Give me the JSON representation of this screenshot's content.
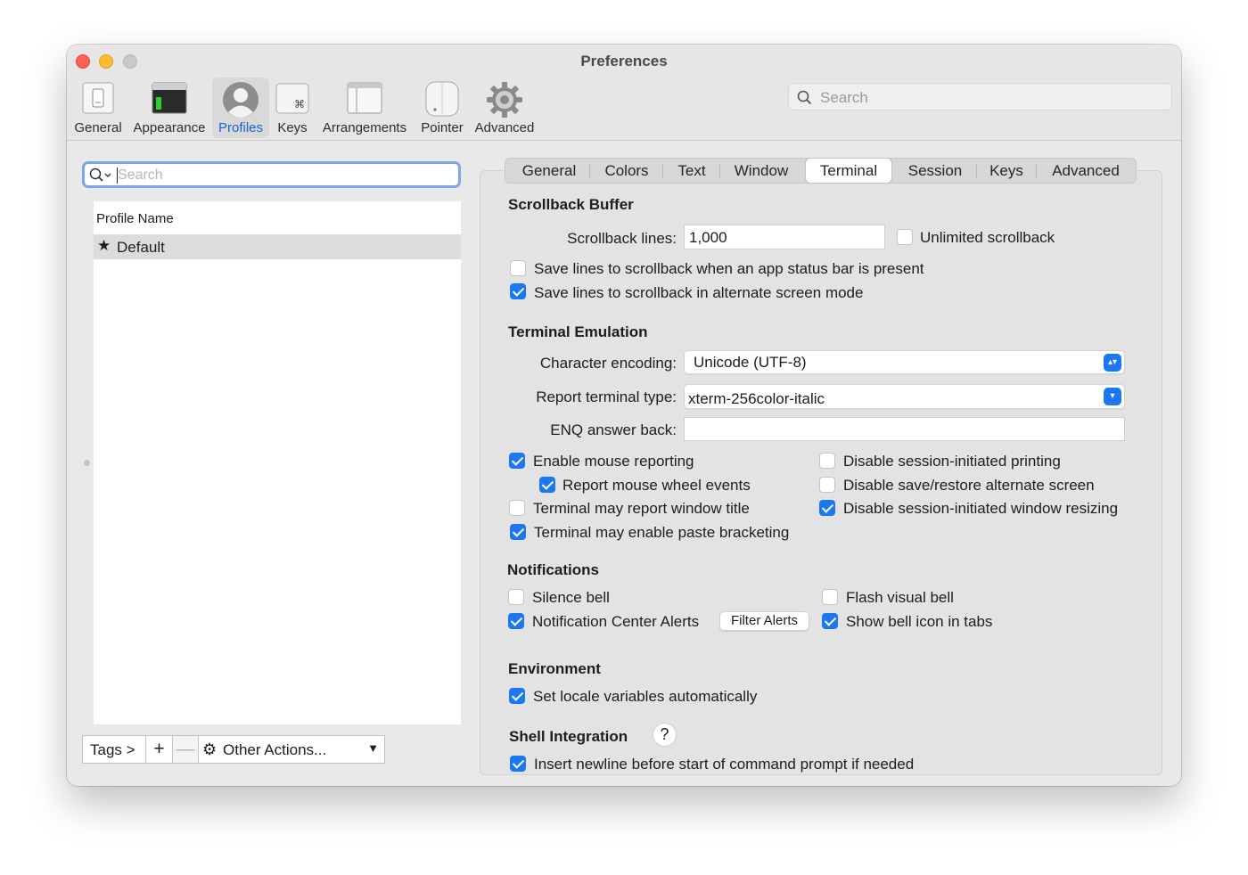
{
  "window": {
    "title": "Preferences"
  },
  "toolbar": {
    "items": [
      {
        "label": "General",
        "icon": "general-icon"
      },
      {
        "label": "Appearance",
        "icon": "appearance-icon"
      },
      {
        "label": "Profiles",
        "icon": "profiles-icon"
      },
      {
        "label": "Keys",
        "icon": "keys-icon"
      },
      {
        "label": "Arrangements",
        "icon": "arrangements-icon"
      },
      {
        "label": "Pointer",
        "icon": "pointer-icon"
      },
      {
        "label": "Advanced",
        "icon": "gear-icon"
      }
    ],
    "selected": "Profiles",
    "search_placeholder": "Search"
  },
  "profiles": {
    "search_placeholder": "Search",
    "column_header": "Profile Name",
    "rows": [
      {
        "name": "Default",
        "is_default": true
      }
    ],
    "tags_label": "Tags >",
    "add_label": "+",
    "remove_label": "—",
    "other_actions_label": "Other Actions..."
  },
  "tabs": {
    "items": [
      "General",
      "Colors",
      "Text",
      "Window",
      "Terminal",
      "Session",
      "Keys",
      "Advanced"
    ],
    "selected": "Terminal"
  },
  "scrollback": {
    "title": "Scrollback Buffer",
    "lines_label": "Scrollback lines:",
    "lines_value": "1,000",
    "unlimited_label": "Unlimited scrollback",
    "unlimited_checked": false,
    "status_bar_label": "Save lines to scrollback when an app status bar is present",
    "status_bar_checked": false,
    "alternate_label": "Save lines to scrollback in alternate screen mode",
    "alternate_checked": true
  },
  "emulation": {
    "title": "Terminal Emulation",
    "encoding_label": "Character encoding:",
    "encoding_value": "Unicode (UTF-8)",
    "report_type_label": "Report terminal type:",
    "report_type_value": "xterm-256color-italic",
    "enq_label": "ENQ answer back:",
    "enq_value": "",
    "options": {
      "mouse_reporting": {
        "label": "Enable mouse reporting",
        "checked": true
      },
      "mouse_wheel": {
        "label": "Report mouse wheel events",
        "checked": true
      },
      "window_title": {
        "label": "Terminal may report window title",
        "checked": false
      },
      "paste_bracketing": {
        "label": "Terminal may enable paste bracketing",
        "checked": true
      },
      "disable_printing": {
        "label": "Disable session-initiated printing",
        "checked": false
      },
      "disable_save_restore": {
        "label": "Disable save/restore alternate screen",
        "checked": false
      },
      "disable_resizing": {
        "label": "Disable session-initiated window resizing",
        "checked": true
      }
    }
  },
  "notifications": {
    "title": "Notifications",
    "silence_bell": {
      "label": "Silence bell",
      "checked": false
    },
    "center_alerts": {
      "label": "Notification Center Alerts",
      "checked": true
    },
    "filter_alerts_label": "Filter Alerts",
    "flash_bell": {
      "label": "Flash visual bell",
      "checked": false
    },
    "bell_icon": {
      "label": "Show bell icon in tabs",
      "checked": true
    }
  },
  "environment": {
    "title": "Environment",
    "locale": {
      "label": "Set locale variables automatically",
      "checked": true
    }
  },
  "shell_integration": {
    "title": "Shell Integration",
    "help_label": "?",
    "newline": {
      "label": "Insert newline before start of command prompt if needed",
      "checked": true
    }
  },
  "colors": {
    "accent": "#1b78f2",
    "selected_toolbar_label": "#1a63d6"
  }
}
